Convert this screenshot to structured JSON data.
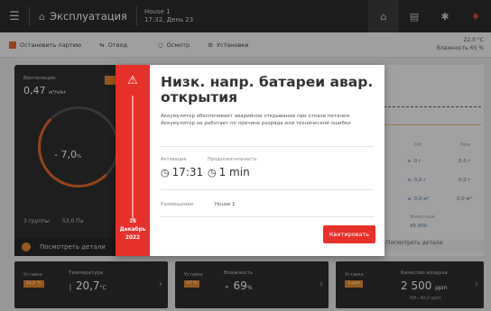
{
  "header": {
    "app_title": "Эксплуатация",
    "house": "House 1",
    "datetime": "17:32, День 23"
  },
  "toolbar": {
    "stop_batch": "Остановить партию",
    "feed": "Отвод",
    "inspection": "Осмотр",
    "settings": "Установки",
    "temperature": "22,0 °C",
    "humidity": "Влажность 65 %"
  },
  "dark_card": {
    "label": "Вентиляция",
    "value": "0,47",
    "unit": "м³/ч/кг",
    "gauge_value": "- 7,0",
    "gauge_unit": "%",
    "groups": "3 группы",
    "pressure": "53,0 Па",
    "footer": "Посмотреть детали"
  },
  "right_card": {
    "h1": "24h",
    "h2": "Now",
    "v1a": "в. 0 г",
    "v1b": "0,0 г",
    "v2a": "в. 0,0 г",
    "v2b": "0,0 г",
    "v3a": "в. 0,0 м³",
    "v3b": "0,0 м³",
    "v4_label": "Животные",
    "v4_value": "45 000",
    "link": "Посмотреть детали"
  },
  "bottom_cards": [
    {
      "set_label": "Уставка",
      "tag": "24,1 °C",
      "name": "Температура",
      "value": "20,7",
      "unit": "°C",
      "sub": ""
    },
    {
      "set_label": "Уставка",
      "tag": "67 %",
      "name": "Влажность",
      "value": "69",
      "unit": "%",
      "sub": ""
    },
    {
      "set_label": "Уставка",
      "tag": "3 ppm",
      "name": "Качество воздуха",
      "value": "2 500",
      "unit": "ppm",
      "sub": "NH₃ 40,0 ppm"
    }
  ],
  "modal": {
    "title": "Низк. напр. батареи авар. открытия",
    "description": "Аккумулятор обеспечивает аварийное открывание при отказе питания. Аккумулятор не работает по причине разряда или технической ошибки",
    "activation_label": "Активация",
    "activation_value": "17:31",
    "duration_label": "Продолжительность",
    "duration_value": "1 min",
    "location_label": "Размещение",
    "location_value": "House 1",
    "date": "16 Декабрь 2022",
    "ack_button": "Квитировать",
    "accent_color": "#e8302a"
  }
}
